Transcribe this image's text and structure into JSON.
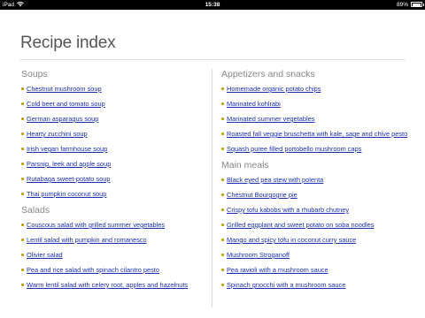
{
  "status_bar": {
    "device": "iPad",
    "time": "15:38",
    "battery": "89%",
    "battery_level": 0.89
  },
  "title": "Recipe index",
  "left_column": {
    "sections": [
      {
        "heading": "Soups",
        "items": [
          "Chestnut mushroom soup",
          "Cold beet and tomato soup",
          "German asparagus soup",
          "Hearty zucchini soup",
          "Irish vegan farmhouse soup",
          "Parsnip, leek and apple soup",
          "Rutabaga sweet-potato soup",
          "Thai pumpkin coconut soup"
        ]
      },
      {
        "heading": "Salads",
        "items": [
          "Couscous salad with grilled summer vegetables",
          "Lentil salad with pumpkin and romanesco",
          "Olivier salad",
          "Pea and rice salad with spinach cilantro pesto",
          "Warm lentil salad with celery root, apples and hazelnuts"
        ]
      }
    ]
  },
  "right_column": {
    "sections": [
      {
        "heading": "Appetizers and snacks",
        "items": [
          "Homemade organic potato chips",
          "Marinated kohlrabi",
          "Marinated summer vegetables",
          "Roasted fall veggie bruschetta with kale, sage and chive pesto",
          "Squash puree filled portobello mushroom caps"
        ]
      },
      {
        "heading": "Main meals",
        "items": [
          "Black eyed pea stew with polenta",
          "Chestnut Bourgogne pie",
          "Crispy tofu kabobs with a rhubarb chutney",
          "Grilled eggplant and sweet potato on soba noodles",
          "Mango and spicy tofu in coconut curry sauce",
          "Mushroom Stroganoff",
          "Pea ravioli with a mushroom sauce",
          "Spinach gnocchi with a mushroom sauce"
        ]
      }
    ]
  },
  "colors": {
    "link": "#1a2fb0",
    "bullet": "#c0a000",
    "heading": "#888888",
    "title": "#555555"
  }
}
